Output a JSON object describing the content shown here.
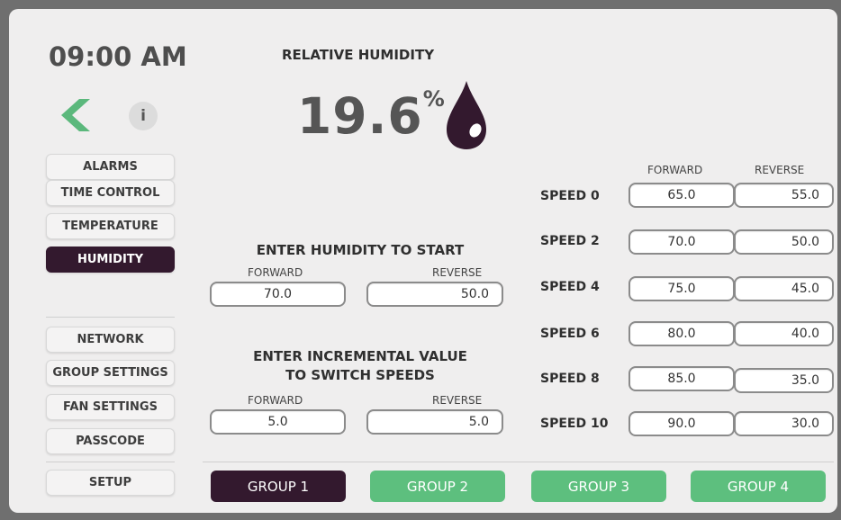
{
  "clock": "09:00 AM",
  "info_label": "i",
  "nav": {
    "top": [
      {
        "name": "alarms",
        "label": "ALARMS",
        "active": false
      },
      {
        "name": "time-control",
        "label": "TIME CONTROL",
        "active": false
      },
      {
        "name": "temperature",
        "label": "TEMPERATURE",
        "active": false
      },
      {
        "name": "humidity",
        "label": "HUMIDITY",
        "active": true
      }
    ],
    "bottom": [
      {
        "name": "network",
        "label": "NETWORK"
      },
      {
        "name": "group-settings",
        "label": "GROUP SETTINGS"
      },
      {
        "name": "fan-settings",
        "label": "FAN SETTINGS"
      },
      {
        "name": "passcode",
        "label": "PASSCODE"
      }
    ],
    "setup": "SETUP"
  },
  "humidity": {
    "title": "RELATIVE HUMIDITY",
    "value": "19.6",
    "unit": "%"
  },
  "start": {
    "title": "ENTER HUMIDITY TO START",
    "forward_label": "FORWARD",
    "reverse_label": "REVERSE",
    "forward_value": "70.0",
    "reverse_value": "50.0"
  },
  "increment": {
    "title_line1": "ENTER INCREMENTAL VALUE",
    "title_line2": "TO SWITCH SPEEDS",
    "forward_label": "FORWARD",
    "reverse_label": "REVERSE",
    "forward_value": "5.0",
    "reverse_value": "5.0"
  },
  "speeds": {
    "forward_header": "FORWARD",
    "reverse_header": "REVERSE",
    "rows": [
      {
        "label": "SPEED 0",
        "forward": "65.0",
        "reverse": "55.0"
      },
      {
        "label": "SPEED 2",
        "forward": "70.0",
        "reverse": "50.0"
      },
      {
        "label": "SPEED 4",
        "forward": "75.0",
        "reverse": "45.0"
      },
      {
        "label": "SPEED 6",
        "forward": "80.0",
        "reverse": "40.0"
      },
      {
        "label": "SPEED 8",
        "forward": "85.0",
        "reverse": "35.0"
      },
      {
        "label": "SPEED 10",
        "forward": "90.0",
        "reverse": "30.0"
      }
    ]
  },
  "groups": [
    {
      "label": "GROUP 1",
      "active": true
    },
    {
      "label": "GROUP 2",
      "active": false
    },
    {
      "label": "GROUP 3",
      "active": false
    },
    {
      "label": "GROUP 4",
      "active": false
    }
  ],
  "colors": {
    "active": "#33192e",
    "green": "#5dbf7e",
    "back_arrow": "#5bb87c",
    "drop": "#33192e"
  }
}
